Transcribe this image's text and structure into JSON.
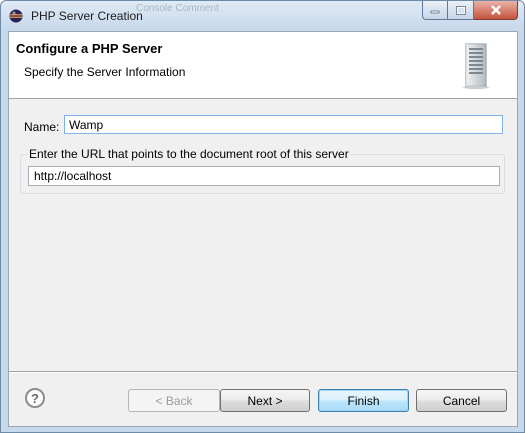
{
  "window": {
    "title": "PHP Server Creation",
    "background_title_text": "Console    Comment",
    "icon": "eclipse-icon",
    "controls": [
      "minimize-icon",
      "maximize-icon",
      "close-icon"
    ]
  },
  "banner": {
    "title": "Configure a PHP Server",
    "subtitle": "Specify the Server Information",
    "icon": "server-icon"
  },
  "form": {
    "name_label": "Name:",
    "name_value": "Wamp",
    "url_group_label": "Enter the URL that points to the document root of this server",
    "url_value": "http://localhost"
  },
  "footer": {
    "help_icon": "help-icon",
    "help_glyph": "?",
    "back_label": "< Back",
    "next_label": "Next >",
    "finish_label": "Finish",
    "cancel_label": "Cancel"
  },
  "colors": {
    "title_bar": "#c8d9ec",
    "close_button": "#c4533c",
    "default_button": "#3c7fb1",
    "focus_border": "#7eb4ea"
  }
}
